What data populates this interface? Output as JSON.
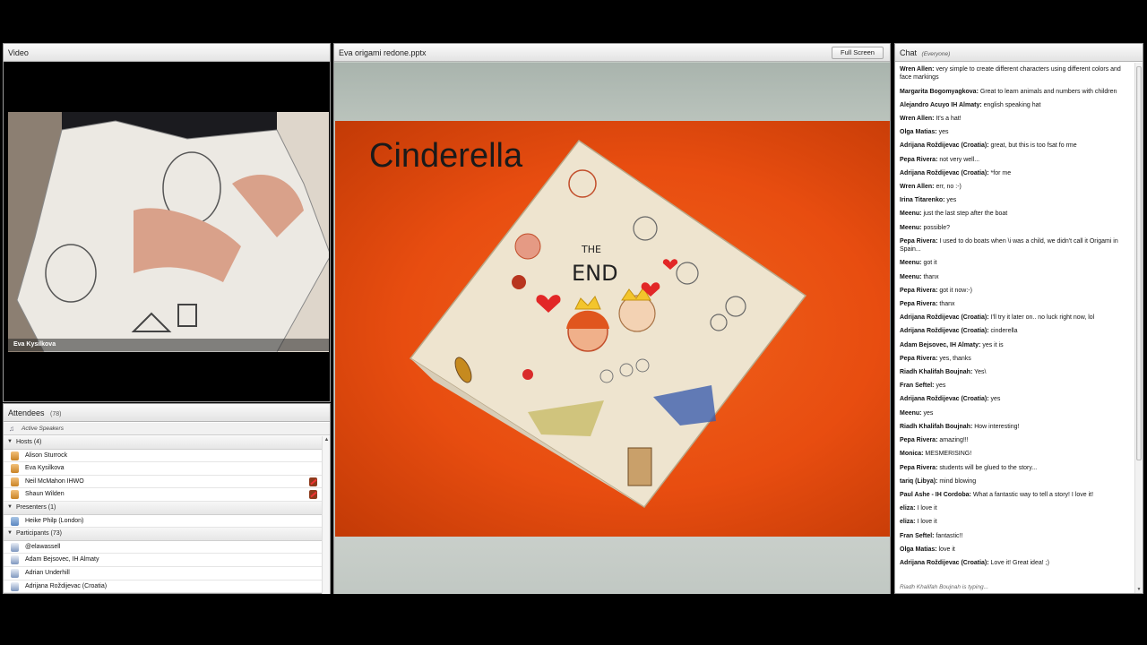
{
  "video": {
    "title": "Video",
    "presenter_name": "Eva Kysilkova"
  },
  "attendees": {
    "title": "Attendees",
    "count": "(78)",
    "active_speakers": "Active Speakers",
    "groups": [
      {
        "label": "Hosts (4)",
        "role": "host",
        "members": [
          {
            "name": "Alison Sturrock",
            "muted": false
          },
          {
            "name": "Eva Kysilkova",
            "muted": false
          },
          {
            "name": "Neil McMahon IHWO",
            "muted": true
          },
          {
            "name": "Shaun Wilden",
            "muted": true
          }
        ]
      },
      {
        "label": "Presenters (1)",
        "role": "presenter",
        "members": [
          {
            "name": "Heike Philp (London)",
            "muted": false
          }
        ]
      },
      {
        "label": "Participants (73)",
        "role": "participant",
        "members": [
          {
            "name": "@elawassell",
            "muted": false
          },
          {
            "name": "Adam Bejsovec, IH Almaty",
            "muted": false
          },
          {
            "name": "Adrian Underhill",
            "muted": false
          },
          {
            "name": "Adrijana Roždijevac (Croatia)",
            "muted": false
          }
        ]
      }
    ]
  },
  "share": {
    "title": "Eva origami redone.pptx",
    "fullscreen_label": "Full Screen",
    "slide_title": "Cinderella",
    "drawing_text_1": "THE",
    "drawing_text_2": "END"
  },
  "chat": {
    "title": "Chat",
    "scope": "(Everyone)",
    "messages": [
      {
        "who": "Wren Allen:",
        "text": "very simple to create different characters using different  colors and face markings"
      },
      {
        "who": "Margarita Bogomyagkova:",
        "text": "Great to learn animals and numbers with children"
      },
      {
        "who": "Alejandro Acuyo IH Almaty:",
        "text": "english speaking hat"
      },
      {
        "who": "Wren Allen:",
        "text": "It's a hat!"
      },
      {
        "who": "Olga Matias:",
        "text": "yes"
      },
      {
        "who": "Adrijana Roždijevac (Croatia):",
        "text": "great, but this is too fsat fo rme"
      },
      {
        "who": "Pepa Rivera:",
        "text": "not very well..."
      },
      {
        "who": "Adrijana Roždijevac (Croatia):",
        "text": "*for me"
      },
      {
        "who": "Wren Allen:",
        "text": "err, no :-)"
      },
      {
        "who": "Irina Titarenko:",
        "text": "yes"
      },
      {
        "who": "Meenu:",
        "text": "just the last step after the boat"
      },
      {
        "who": "Meenu:",
        "text": "possible?"
      },
      {
        "who": "Pepa Rivera:",
        "text": "I used to do boats when \\i was a child, we didn't call it Origami in Spain..."
      },
      {
        "who": "Meenu:",
        "text": "got it"
      },
      {
        "who": "Meenu:",
        "text": "thanx"
      },
      {
        "who": "Pepa Rivera:",
        "text": "got it now:-)"
      },
      {
        "who": "Pepa Rivera:",
        "text": "thanx"
      },
      {
        "who": "Adrijana Roždijevac (Croatia):",
        "text": "I'll try it later on.. no luck right now, lol"
      },
      {
        "who": "Adrijana Roždijevac (Croatia):",
        "text": "cinderella"
      },
      {
        "who": "Adam Bejsovec, IH Almaty:",
        "text": "yes it is"
      },
      {
        "who": "Pepa Rivera:",
        "text": "yes, thanks"
      },
      {
        "who": "Riadh Khalifah Boujnah:",
        "text": "Yes\\"
      },
      {
        "who": "Fran Seftel:",
        "text": "yes"
      },
      {
        "who": "Adrijana Roždijevac (Croatia):",
        "text": "yes"
      },
      {
        "who": "Meenu:",
        "text": "yes"
      },
      {
        "who": "Riadh Khalifah Boujnah:",
        "text": "How interesting!"
      },
      {
        "who": "Pepa Rivera:",
        "text": "amazing!!!"
      },
      {
        "who": "Monica:",
        "text": "MESMERISING!"
      },
      {
        "who": "Pepa Rivera:",
        "text": "students will be glued to the story..."
      },
      {
        "who": "tariq (Libya):",
        "text": "mind blowing"
      },
      {
        "who": "Paul Ashe - IH Cordoba:",
        "text": "What a fantastic way to tell a story! I love it!"
      },
      {
        "who": "eliza:",
        "text": "I love it"
      },
      {
        "who": "eliza:",
        "text": "I love it"
      },
      {
        "who": "Fran Seftel:",
        "text": "fantastic!!"
      },
      {
        "who": "Olga Matias:",
        "text": "love it"
      },
      {
        "who": "Adrijana Roždijevac (Croatia):",
        "text": "Love it! Great idea! ;)"
      }
    ],
    "typing": "Riadh Khalifah Boujnah is typing..."
  }
}
